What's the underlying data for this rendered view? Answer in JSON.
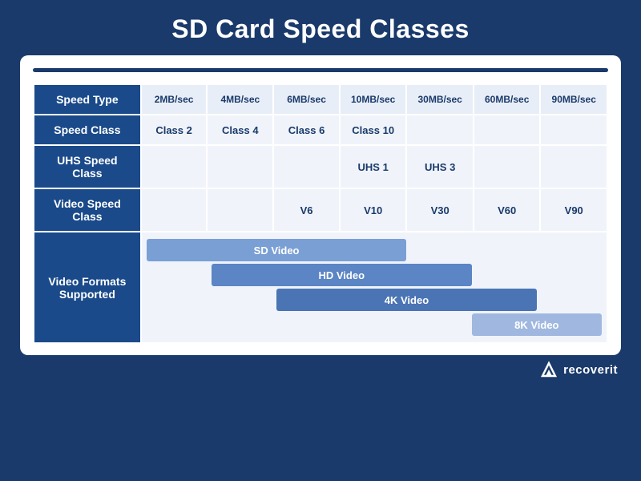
{
  "title": "SD Card Speed Classes",
  "card": {
    "rows": [
      {
        "label": "Speed Type",
        "cells": [
          "2MB/sec",
          "4MB/sec",
          "6MB/sec",
          "10MB/sec",
          "30MB/sec",
          "60MB/sec",
          "90MB/sec"
        ]
      },
      {
        "label": "Speed Class",
        "cells": [
          "Class 2",
          "Class 4",
          "Class 6",
          "Class 10",
          "",
          "",
          ""
        ]
      },
      {
        "label": "UHS Speed Class",
        "cells": [
          "",
          "",
          "",
          "UHS 1",
          "UHS 3",
          "",
          ""
        ]
      },
      {
        "label": "Video Speed Class",
        "cells": [
          "",
          "",
          "V6",
          "V10",
          "V30",
          "V60",
          "V90"
        ]
      }
    ],
    "video_formats_label": "Video Formats\nSupported",
    "video_formats": [
      {
        "label": "SD Video",
        "start": 0,
        "span": 4,
        "color": "#7a9fd4"
      },
      {
        "label": "HD Video",
        "start": 1,
        "span": 4,
        "color": "#5b85c4"
      },
      {
        "label": "4K Video",
        "start": 2,
        "span": 4,
        "color": "#4a74b4"
      },
      {
        "label": "8K Video",
        "start": 5,
        "span": 2,
        "color": "#a0b8e0"
      }
    ]
  },
  "logo": {
    "text": "recoverit"
  }
}
